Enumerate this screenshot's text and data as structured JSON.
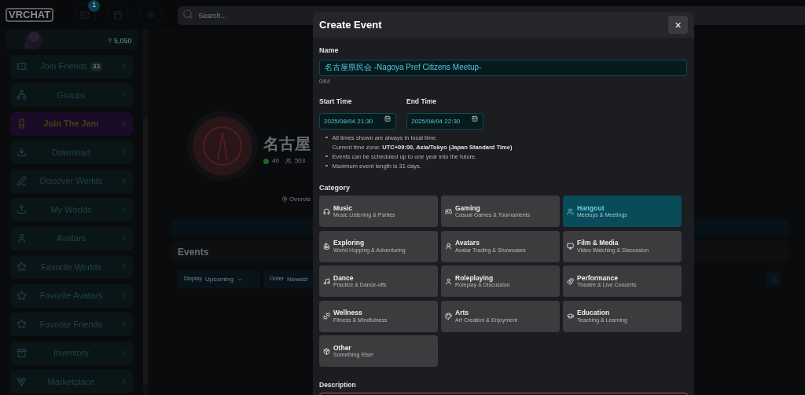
{
  "topbar": {
    "logo": "VRCHAT",
    "mail_badge": "1",
    "search": {
      "placeholder": "Search..."
    }
  },
  "profile": {
    "balance": "5,050"
  },
  "sidebar": {
    "items": [
      {
        "label": "Join Friends",
        "badge": "33",
        "kind": "link"
      },
      {
        "label": "Groups",
        "kind": "link"
      },
      {
        "label": "Join The Jam",
        "kind": "promo"
      },
      {
        "label": "Download",
        "kind": "link"
      },
      {
        "label": "Discover Worlds",
        "kind": "link"
      },
      {
        "label": "My Worlds",
        "kind": "link"
      },
      {
        "label": "Avatars",
        "kind": "link"
      },
      {
        "label": "Favorite Worlds",
        "kind": "link"
      },
      {
        "label": "Favorite Avatars",
        "kind": "link"
      },
      {
        "label": "Favorite Friends",
        "kind": "link"
      },
      {
        "label": "Inventory",
        "kind": "link"
      },
      {
        "label": "Marketplace",
        "kind": "link"
      }
    ]
  },
  "group": {
    "title": "名古屋",
    "online": "40",
    "members": "503",
    "tab": "Overvie"
  },
  "events": {
    "title": "Events",
    "display_label": "Display",
    "display_value": "Upcoming",
    "order_label": "Order",
    "order_value": "Newest"
  },
  "modal": {
    "title": "Create Event",
    "close": "×",
    "name": {
      "label": "Name",
      "value": "名古屋県民会 -Nagoya Pref Citizens Meetup-",
      "counter": "0/64"
    },
    "start": {
      "label": "Start Time",
      "value": "2025/08/04 21:30"
    },
    "end": {
      "label": "End Time",
      "value": "2025/08/04 22:30"
    },
    "notes": [
      {
        "text": "All times shown are always in local time.",
        "detail": "Current time zone: **UTC+09:00, Asia/Tokyo (Japan Standard Time)**"
      },
      {
        "text": "Events can be scheduled up to one year into the future."
      },
      {
        "text": "Maximum event length is 31 days."
      }
    ],
    "category_label": "Category",
    "categories": [
      {
        "title": "Music",
        "subtitle": "Music Listening & Parties",
        "selected": false
      },
      {
        "title": "Gaming",
        "subtitle": "Casual Games & Tournaments",
        "selected": false
      },
      {
        "title": "Hangout",
        "subtitle": "Meetups & Meetings",
        "selected": true
      },
      {
        "title": "Exploring",
        "subtitle": "World Hopping & Adventuring",
        "selected": false
      },
      {
        "title": "Avatars",
        "subtitle": "Avatar Trading & Showcases",
        "selected": false
      },
      {
        "title": "Film & Media",
        "subtitle": "Video Watching & Discussion",
        "selected": false
      },
      {
        "title": "Dance",
        "subtitle": "Practice & Dance-offs",
        "selected": false
      },
      {
        "title": "Roleplaying",
        "subtitle": "Roleplay & Discussion",
        "selected": false
      },
      {
        "title": "Performance",
        "subtitle": "Theatre & Live Concerts",
        "selected": false
      },
      {
        "title": "Wellness",
        "subtitle": "Fitness & Mindfulness",
        "selected": false
      },
      {
        "title": "Arts",
        "subtitle": "Art Creation & Enjoyment",
        "selected": false
      },
      {
        "title": "Education",
        "subtitle": "Teaching & Learning",
        "selected": false
      },
      {
        "title": "Other",
        "subtitle": "Something Else!",
        "selected": false
      }
    ],
    "description_label": "Description"
  }
}
